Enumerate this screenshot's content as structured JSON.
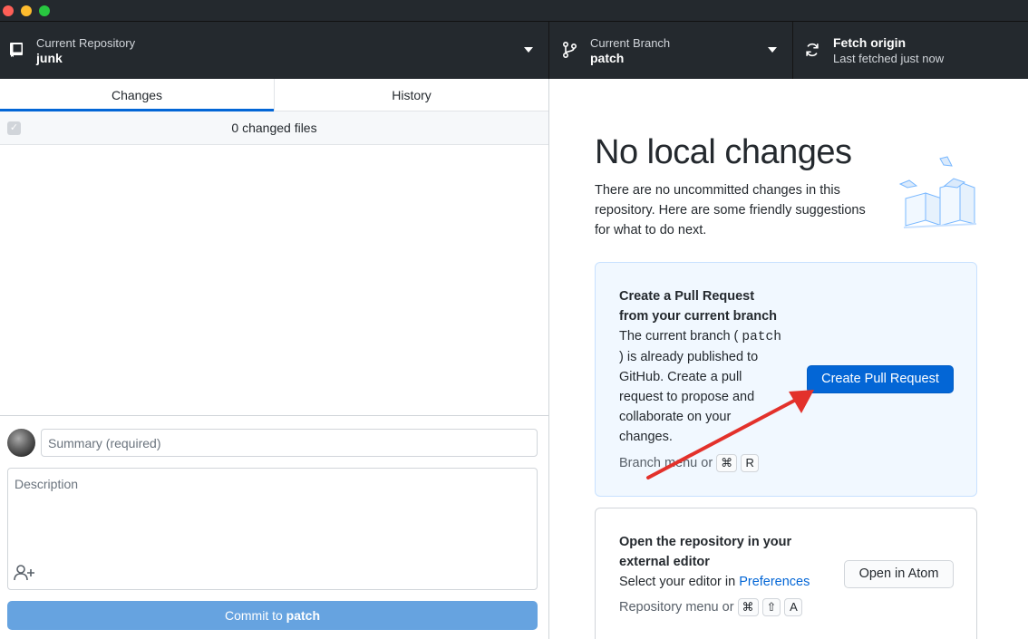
{
  "toolbar": {
    "repo_label": "Current Repository",
    "repo_value": "junk",
    "branch_label": "Current Branch",
    "branch_value": "patch",
    "fetch_label": "Fetch origin",
    "fetch_value": "Last fetched just now"
  },
  "tabs": {
    "changes": "Changes",
    "history": "History"
  },
  "files": {
    "count_text": "0 changed files"
  },
  "commit": {
    "summary_placeholder": "Summary (required)",
    "description_placeholder": "Description",
    "button_prefix": "Commit to",
    "button_branch": "patch"
  },
  "main": {
    "heading": "No local changes",
    "subtext": "There are no uncommitted changes in this repository. Here are some friendly suggestions for what to do next."
  },
  "pr_card": {
    "title": "Create a Pull Request from your current branch",
    "body_prefix": "The current branch (",
    "body_branch": "patch",
    "body_suffix": ") is already published to GitHub. Create a pull request to propose and collaborate on your changes.",
    "hint": "Branch menu or",
    "key1": "⌘",
    "key2": "R",
    "button": "Create Pull Request"
  },
  "editor_card": {
    "title": "Open the repository in your external editor",
    "body_prefix": "Select your editor in",
    "body_link": "Preferences",
    "hint": "Repository menu or",
    "key1": "⌘",
    "key2": "⇧",
    "key3": "A",
    "button": "Open in Atom"
  },
  "colors": {
    "accent": "#0366d6",
    "toolbar_bg": "#24292e",
    "annotation_arrow": "#e3312b"
  }
}
